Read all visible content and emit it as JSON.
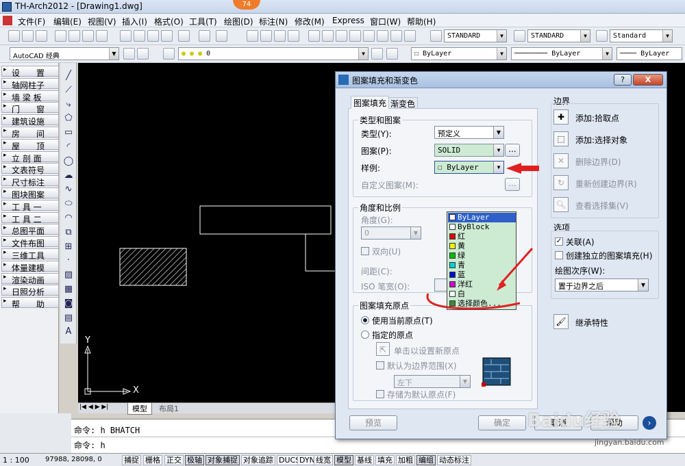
{
  "window": {
    "title": "TH-Arch2012 - [Drawing1.dwg]",
    "badge": "74"
  },
  "menu": [
    "文件(F)",
    "编辑(E)",
    "视图(V)",
    "插入(I)",
    "格式(O)",
    "工具(T)",
    "绘图(D)",
    "标注(N)",
    "Express",
    "窗口(W)",
    "帮助(H)"
  ],
  "toolbar": {
    "text_style": "STANDARD",
    "dim_style": "STANDARD",
    "table_style": "Standard",
    "workspace": "AutoCAD 经典",
    "layer": "0",
    "color": "ByLayer",
    "linetype": "ByLayer",
    "lineweight": "ByLayer"
  },
  "left_menu": [
    "设　　置",
    "轴网柱子",
    "墙 梁 板",
    "门　　窗",
    "建筑设施",
    "房　　间",
    "屋　　顶",
    "立 剖 面",
    "文表符号",
    "尺寸标注",
    "图块图案",
    "工 具 一",
    "工 具 二",
    "总图平面",
    "文件布图",
    "三维工具",
    "体量建模",
    "渲染动画",
    "日照分析",
    "帮　　助"
  ],
  "draw_icons": [
    "line-icon",
    "xline-icon",
    "pline-icon",
    "polygon-icon",
    "rectangle-icon",
    "arc-icon",
    "circle-icon",
    "revcloud-icon",
    "spline-icon",
    "ellipse-icon",
    "ellipse-arc-icon",
    "insert-block-icon",
    "make-block-icon",
    "point-icon",
    "hatch-icon",
    "gradient-icon",
    "region-icon",
    "table-icon",
    "mtext-icon"
  ],
  "canvas": {
    "ucs_x": "X",
    "ucs_y": "Y"
  },
  "layout_tabs": {
    "model": "模型",
    "layout1": "布局1"
  },
  "command": {
    "line1": "命令: h BHATCH",
    "line2": "命令: h"
  },
  "status": {
    "scale": "1 : 100",
    "coords": "97988, 28098, 0",
    "buttons": [
      "捕捉",
      "栅格",
      "正交",
      "极轴",
      "对象捕捉",
      "对象追踪",
      "DUCS",
      "DYN",
      "线宽",
      "模型",
      "基线",
      "填充",
      "加粗",
      "编组",
      "动态标注"
    ]
  },
  "dialog": {
    "title": "图案填充和渐变色",
    "help_btn": "?",
    "close_btn": "X",
    "tabs": [
      "图案填充",
      "渐变色"
    ],
    "type_group": "类型和图案",
    "type_label": "类型(Y):",
    "type_value": "预定义",
    "pattern_label": "图案(P):",
    "pattern_value": "SOLID",
    "browse": "...",
    "swatch_label": "样例:",
    "swatch_value": "ByLayer",
    "custom_label": "自定义图案(M):",
    "angle_group": "角度和比例",
    "angle_label": "角度(G):",
    "angle_value": "0",
    "double_label": "双向(U)",
    "spacing_label": "间距(C):",
    "iso_label": "ISO 笔宽(O):",
    "origin_group": "图案填充原点",
    "origin_current": "使用当前原点(T)",
    "origin_specified": "指定的原点",
    "origin_click": "单击以设置新原点",
    "origin_default_extent": "默认为边界范围(X)",
    "origin_pos": "左下",
    "origin_store": "存储为默认原点(F)",
    "color_list": [
      {
        "name": "ByLayer",
        "color": "#ffffff"
      },
      {
        "name": "ByBlock",
        "color": "#ffffff"
      },
      {
        "name": "红",
        "color": "#e00000"
      },
      {
        "name": "黄",
        "color": "#f0f000"
      },
      {
        "name": "绿",
        "color": "#00c000"
      },
      {
        "name": "青",
        "color": "#00d0d0"
      },
      {
        "name": "蓝",
        "color": "#0010d0"
      },
      {
        "name": "洋红",
        "color": "#d000d0"
      },
      {
        "name": "白",
        "color": "#ffffff"
      },
      {
        "name": "选择颜色...",
        "color": "#3a8a3a"
      }
    ],
    "boundary_group": "边界",
    "add_pick": "添加:拾取点",
    "add_select": "添加:选择对象",
    "remove_boundary": "删除边界(D)",
    "recreate_boundary": "重新创建边界(R)",
    "view_selection": "查看选择集(V)",
    "options_group": "选项",
    "associative": "关联(A)",
    "independent": "创建独立的图案填充(H)",
    "draw_order_label": "绘图次序(W):",
    "draw_order_value": "置于边界之后",
    "inherit": "继承特性",
    "preview_btn": "预览",
    "ok_btn": "确定",
    "cancel_btn": "取消",
    "help_bottom": "帮助"
  },
  "watermark": {
    "brand": "Baidu经验",
    "url": "jingyan.baidu.com"
  }
}
